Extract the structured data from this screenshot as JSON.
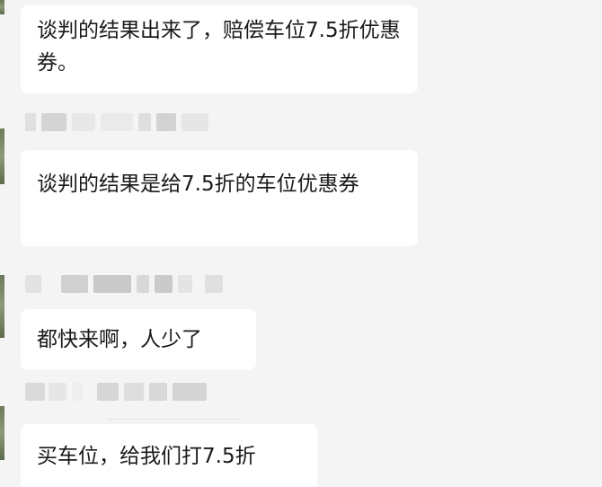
{
  "messages": [
    {
      "text": "谈判的结果出来了，赔偿车位7.5折优惠券。"
    },
    {
      "text": "谈判的结果是给7.5折的车位优惠券"
    },
    {
      "text": "都快来啊，人少了"
    },
    {
      "text": "买车位，给我们打7.5折"
    }
  ],
  "colors": {
    "background": "#f4f4f4",
    "bubble": "#ffffff",
    "text": "#1a1a1a",
    "name_blur": "#d9d9d9"
  }
}
